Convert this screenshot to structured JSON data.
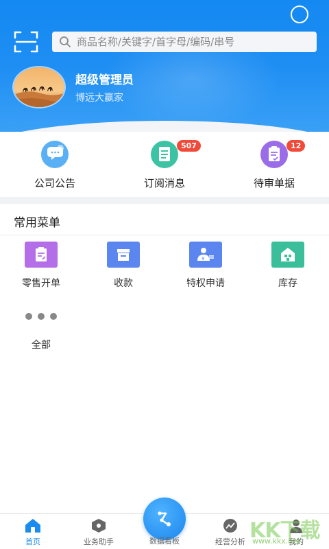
{
  "header": {
    "search_placeholder": "商品名称/关键字/首字母/编码/串号",
    "user_name": "超级管理员",
    "company": "博远大赢家"
  },
  "quick_actions": [
    {
      "label": "公司公告",
      "icon": "chat-bubble-icon",
      "badge": ""
    },
    {
      "label": "订阅消息",
      "icon": "document-icon",
      "badge": "507"
    },
    {
      "label": "待审单据",
      "icon": "clipboard-check-icon",
      "badge": "12"
    }
  ],
  "common_menu": {
    "title": "常用菜单",
    "items": [
      {
        "label": "零售开单",
        "icon": "retail-order-icon",
        "color": "#b46fe8"
      },
      {
        "label": "收款",
        "icon": "payment-box-icon",
        "color": "#5b86ef"
      },
      {
        "label": "特权申请",
        "icon": "privilege-user-icon",
        "color": "#5b86ef"
      },
      {
        "label": "库存",
        "icon": "inventory-icon",
        "color": "#3bbf9a"
      },
      {
        "label": "全部",
        "icon": "more-dots-icon",
        "color": "#888888"
      }
    ]
  },
  "bottom_nav": {
    "items": [
      {
        "label": "首页",
        "active": true
      },
      {
        "label": "业务助手",
        "active": false
      },
      {
        "label": "数据看板",
        "active": false
      },
      {
        "label": "经营分析",
        "active": false
      },
      {
        "label": "我的",
        "active": false
      }
    ]
  },
  "watermark": {
    "brand": "KK下载",
    "url": "www.kkx.net"
  },
  "colors": {
    "primary": "#1a8cf0",
    "badge": "#f04a3a"
  }
}
